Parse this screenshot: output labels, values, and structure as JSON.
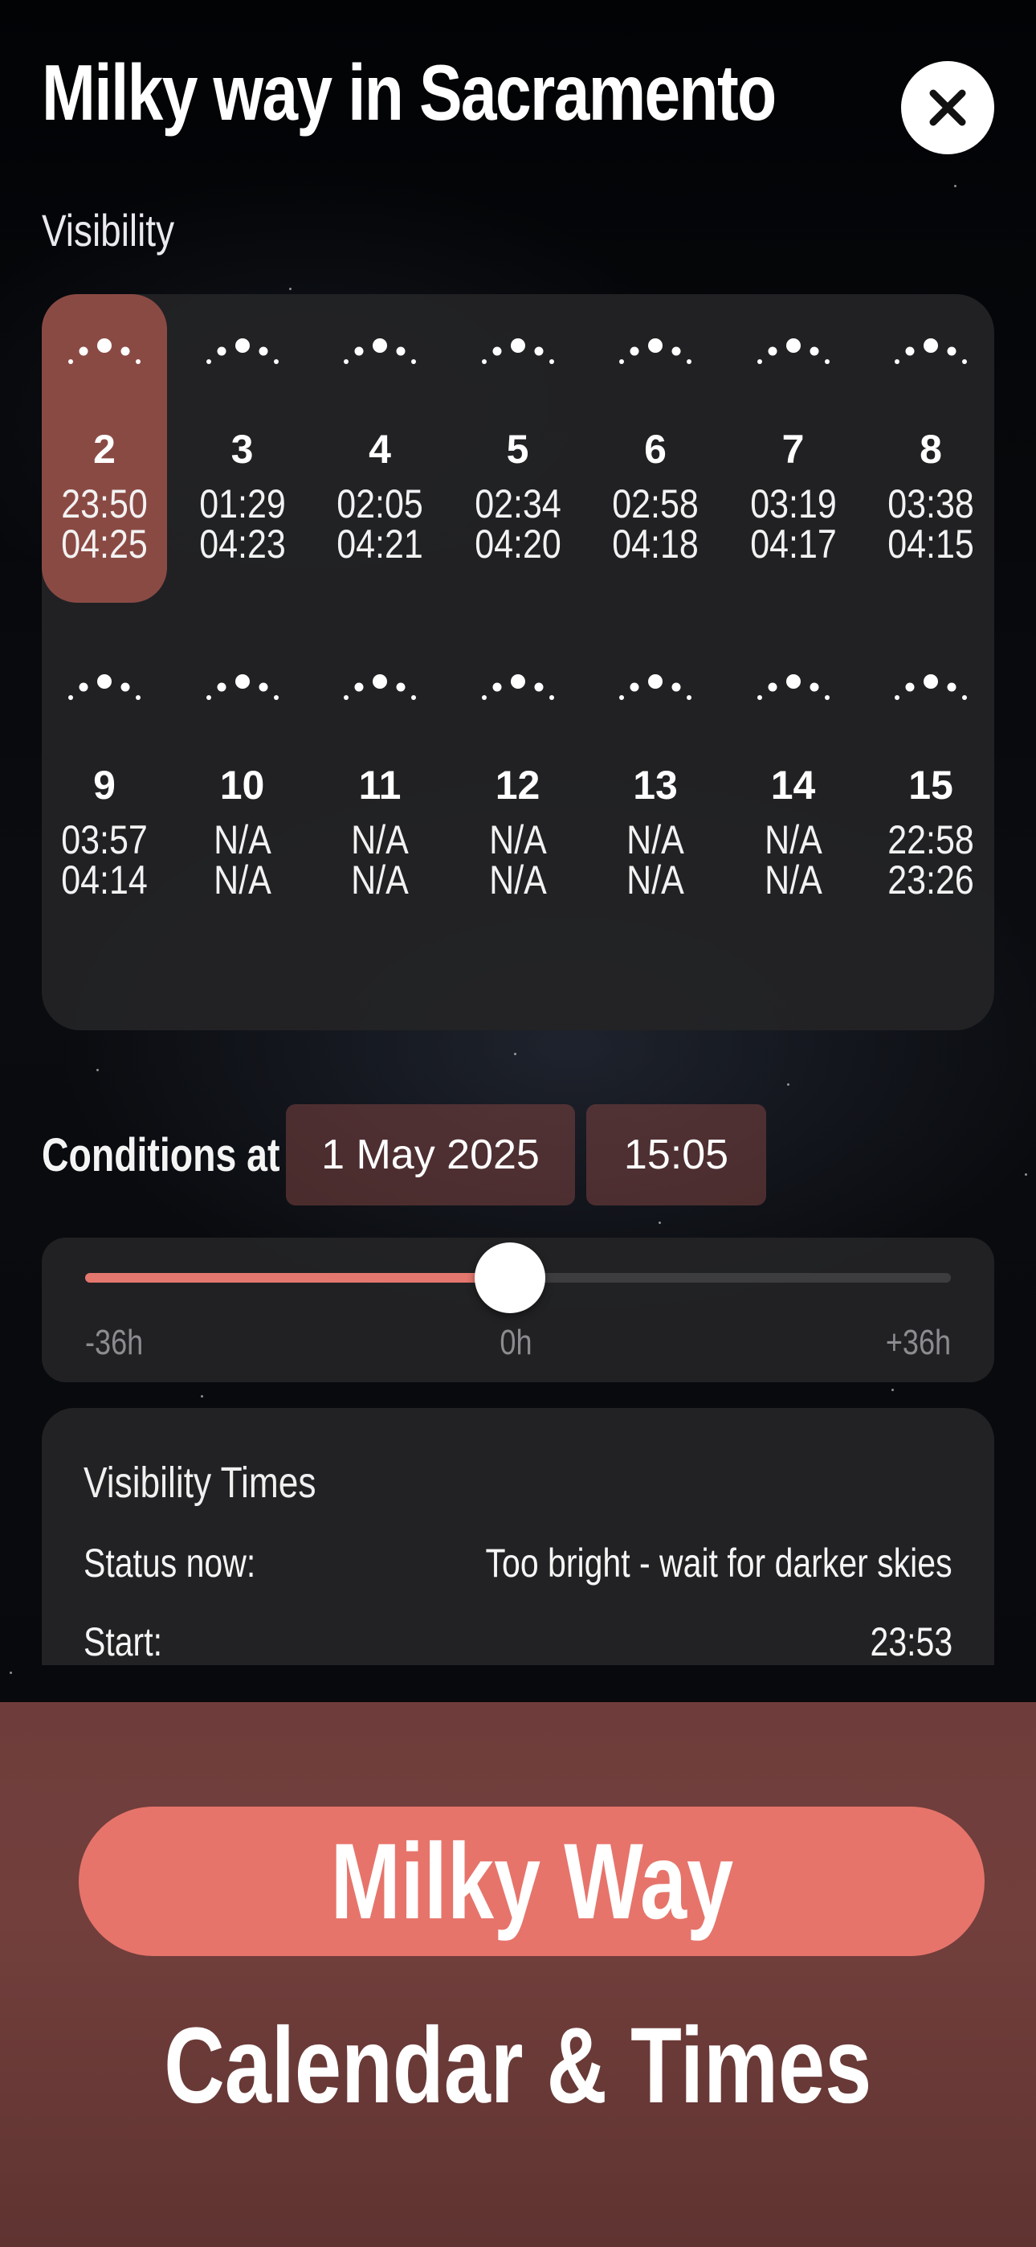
{
  "header": {
    "title": "Milky way in Sacramento",
    "close_icon": "close-icon"
  },
  "visibility": {
    "label": "Visibility",
    "selected_day": "2",
    "days": [
      {
        "day": "2",
        "start": "23:50",
        "end": "04:25"
      },
      {
        "day": "3",
        "start": "01:29",
        "end": "04:23"
      },
      {
        "day": "4",
        "start": "02:05",
        "end": "04:21"
      },
      {
        "day": "5",
        "start": "02:34",
        "end": "04:20"
      },
      {
        "day": "6",
        "start": "02:58",
        "end": "04:18"
      },
      {
        "day": "7",
        "start": "03:19",
        "end": "04:17"
      },
      {
        "day": "8",
        "start": "03:38",
        "end": "04:15"
      },
      {
        "day": "9",
        "start": "03:57",
        "end": "04:14"
      },
      {
        "day": "10",
        "start": "N/A",
        "end": "N/A"
      },
      {
        "day": "11",
        "start": "N/A",
        "end": "N/A"
      },
      {
        "day": "12",
        "start": "N/A",
        "end": "N/A"
      },
      {
        "day": "13",
        "start": "N/A",
        "end": "N/A"
      },
      {
        "day": "14",
        "start": "N/A",
        "end": "N/A"
      },
      {
        "day": "15",
        "start": "22:58",
        "end": "23:26"
      }
    ],
    "icon": "milky-way-arc-icon"
  },
  "conditions": {
    "label": "Conditions at",
    "date": "1 May 2025",
    "time": "15:05"
  },
  "time_slider": {
    "min_label": "-36h",
    "mid_label": "0h",
    "max_label": "+36h",
    "value_fraction": 0.5,
    "accent_color": "#e4776e"
  },
  "visibility_times": {
    "title": "Visibility Times",
    "status_label": "Status now:",
    "status_value": "Too bright - wait for darker skies",
    "start_label": "Start:",
    "start_value": "23:53"
  },
  "promo": {
    "button_label": "Milky Way",
    "subtitle": "Calendar & Times",
    "button_color": "#e6746b",
    "background_color": "#6e3d3b"
  }
}
